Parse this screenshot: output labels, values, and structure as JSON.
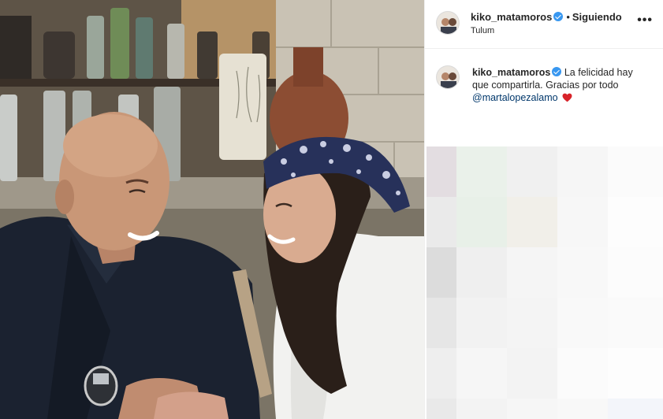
{
  "post": {
    "username": "kiko_matamoros",
    "follow_status": "Siguiendo",
    "separator": "•",
    "location": "Tulum",
    "more_label": "•••",
    "caption": {
      "username": "kiko_matamoros",
      "text": "La felicidad hay que compartirla. Gracias por todo",
      "mention": "@martalopezalamo"
    }
  },
  "colors": {
    "verified": "#3897f0",
    "mention": "#00376b",
    "heart": "#ed4956",
    "text": "#262626"
  },
  "icons": {
    "verified": "verified-badge-icon",
    "more": "more-options-icon",
    "heart": "red-heart-emoji-icon"
  }
}
